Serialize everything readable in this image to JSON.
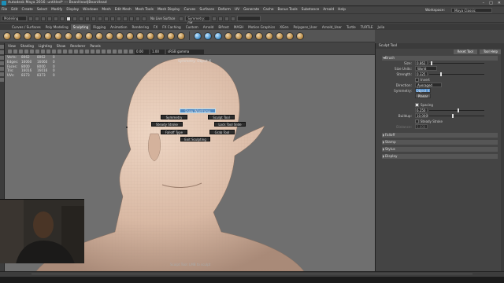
{
  "titlebar": {
    "title": "Autodesk Maya 2016: untitled* --- BeanHead|BeanHead",
    "controls": [
      "–",
      "□",
      "✕"
    ]
  },
  "menubar": {
    "items": [
      "File",
      "Edit",
      "Create",
      "Select",
      "Modify",
      "Display",
      "Windows",
      "Mesh",
      "Edit Mesh",
      "Mesh Tools",
      "Mesh Display",
      "Curves",
      "Surfaces",
      "Deform",
      "UV",
      "Generate",
      "Cache",
      "Bonus Tools",
      "Substance",
      "Arnold",
      "Help"
    ],
    "workspace_label": "Workspace:",
    "workspace_value": "Maya Classic"
  },
  "statusline": {
    "mode_menu": "Modeling",
    "live_surface": "No Live Surface",
    "symmetry_field": "Symmetry: Off"
  },
  "shelf": {
    "tabs": [
      "Curves / Surfaces",
      "Poly Modeling",
      "Sculpting",
      "Rigging",
      "Animation",
      "Rendering",
      "FX",
      "FX Caching",
      "Custom",
      "Arnold",
      "Bifrost",
      "MASH",
      "Motion Graphics",
      "XGen",
      "Polygons_User",
      "Arnold_User",
      "Turtle",
      "TURTLE",
      "Julia"
    ],
    "active_tab": "Sculpting",
    "tool_count_note": ""
  },
  "viewport": {
    "menu": [
      "View",
      "Shading",
      "Lighting",
      "Show",
      "Renderer",
      "Panels"
    ],
    "fields": {
      "near": "0.00",
      "far": "1.00",
      "color_space": "sRGB gamma"
    },
    "camera_label": "Symmetry: Object X",
    "hud": {
      "rows": [
        {
          "label": "Verts:",
          "a": "8062",
          "b": "8062",
          "c": "0"
        },
        {
          "label": "Edges:",
          "a": "16060",
          "b": "16060",
          "c": "0"
        },
        {
          "label": "Faces:",
          "a": "8000",
          "b": "8000",
          "c": "0"
        },
        {
          "label": "Tris:",
          "a": "16016",
          "b": "16016",
          "c": "0"
        },
        {
          "label": "UVs:",
          "a": "8373",
          "b": "8373",
          "c": "0"
        }
      ]
    },
    "marking_menu": {
      "center": "Show Wireframe",
      "items": {
        "north_left": "Symmetry",
        "north_right": "Sculpt Tool",
        "west": "Steady Stroke",
        "east": "Lock Tool Slide",
        "southwest": "Falloff Type",
        "southeast": "Grab Tool",
        "south": "Exit Sculpting"
      }
    },
    "helpline": "Sculpt Tool: LMB to sculpt"
  },
  "tool_settings": {
    "title": "Sculpt Tool",
    "reset_button": "Reset Tool",
    "help_button": "Tool Help",
    "brush_section": "Brush",
    "size": {
      "label": "Size:",
      "value": "0.862",
      "fraction": 0.03
    },
    "size_units": {
      "label": "Size Units:",
      "value": "World"
    },
    "strength": {
      "label": "Strength:",
      "value": "0.325",
      "fraction": 0.2
    },
    "invert": {
      "label": "Invert",
      "checked": false
    },
    "direction": {
      "label": "Direction:",
      "value": "Averaged Normal"
    },
    "symmetry": {
      "label": "Symmetry:",
      "value": "Object X"
    },
    "planar": {
      "label": "Planar"
    },
    "spacing": {
      "label": "Spacing",
      "checked": true,
      "value": "6.250",
      "fraction": 0.52
    },
    "buildup": {
      "label": "Buildup:",
      "value": "10.000",
      "fraction": 0.42
    },
    "steady_stroke": {
      "label": "Steady Stroke",
      "checked": false
    },
    "distance": {
      "label": "Distance:",
      "value": "5.000"
    },
    "collapsed_sections": [
      "Falloff",
      "Stamp",
      "Stylus",
      "Display"
    ]
  }
}
